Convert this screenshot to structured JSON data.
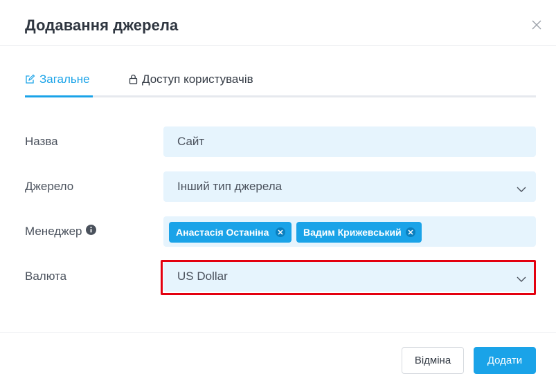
{
  "dialog": {
    "title": "Додавання джерела"
  },
  "tabs": [
    {
      "label": "Загальне",
      "icon": "edit-icon",
      "active": true
    },
    {
      "label": "Доступ користувачів",
      "icon": "lock-icon",
      "active": false
    }
  ],
  "form": {
    "name": {
      "label": "Назва",
      "value": "Сайт"
    },
    "source": {
      "label": "Джерело",
      "value": "Інший тип джерела"
    },
    "manager": {
      "label": "Менеджер",
      "info_icon": "info-icon",
      "tags": [
        "Анастасія Останіна",
        "Вадим Крижевський"
      ]
    },
    "currency": {
      "label": "Валюта",
      "value": "US Dollar"
    }
  },
  "footer": {
    "cancel_label": "Відміна",
    "add_label": "Додати"
  },
  "colors": {
    "accent": "#1aa3e8",
    "field_bg": "#e6f4fd",
    "highlight": "#e3000f"
  }
}
